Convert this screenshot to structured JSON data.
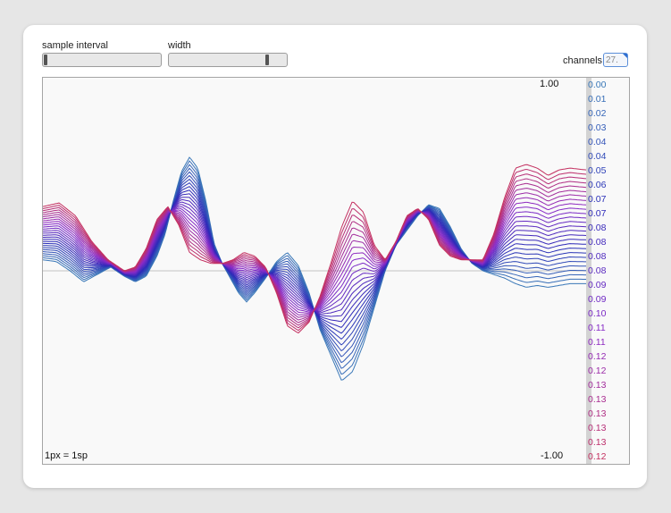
{
  "controls": {
    "sample_interval_label": "sample interval",
    "sample_interval_value": 0.0,
    "width_label": "width",
    "width_value": 0.85,
    "channels_label": "channels",
    "channels_value": "27."
  },
  "colors": {
    "trace_start": "#3a78b8",
    "trace_mid": "#2a2ab8",
    "trace_late": "#8a2ac8",
    "trace_end": "#c43060",
    "baseline": "#cfcfcf"
  },
  "plot": {
    "ymax_label": "1.00",
    "ymin_label": "-1.00",
    "scale_label": "1px = 1sp"
  },
  "chart_data": {
    "type": "line",
    "ylim": [
      -1,
      1
    ],
    "channel_count": 27,
    "channel_values": [
      "0.00",
      "0.01",
      "0.02",
      "0.03",
      "0.04",
      "0.04",
      "0.05",
      "0.06",
      "0.07",
      "0.07",
      "0.08",
      "0.08",
      "0.08",
      "0.08",
      "0.09",
      "0.09",
      "0.10",
      "0.11",
      "0.11",
      "0.12",
      "0.12",
      "0.13",
      "0.13",
      "0.13",
      "0.13",
      "0.13",
      "0.12"
    ],
    "first_channel_x": [
      0,
      0.025,
      0.05,
      0.075,
      0.1,
      0.125,
      0.15,
      0.17,
      0.19,
      0.21,
      0.225,
      0.24,
      0.255,
      0.27,
      0.285,
      0.3,
      0.315,
      0.33,
      0.345,
      0.36,
      0.375,
      0.39,
      0.41,
      0.43,
      0.45,
      0.47,
      0.49,
      0.51,
      0.53,
      0.55,
      0.57,
      0.59,
      0.61,
      0.63,
      0.65,
      0.67,
      0.69,
      0.71,
      0.73,
      0.75,
      0.77,
      0.79,
      0.81,
      0.83,
      0.85,
      0.87,
      0.89,
      0.91,
      0.93,
      0.95,
      0.97,
      1.0
    ],
    "first_channel_y": [
      0.06,
      0.05,
      0.0,
      -0.06,
      -0.02,
      0.02,
      -0.03,
      -0.06,
      -0.03,
      0.08,
      0.2,
      0.38,
      0.54,
      0.62,
      0.56,
      0.38,
      0.15,
      0.04,
      -0.04,
      -0.12,
      -0.17,
      -0.12,
      -0.04,
      0.05,
      0.1,
      0.03,
      -0.12,
      -0.32,
      -0.46,
      -0.6,
      -0.55,
      -0.4,
      -0.2,
      0.0,
      0.14,
      0.22,
      0.3,
      0.36,
      0.34,
      0.24,
      0.12,
      0.04,
      0.0,
      -0.02,
      -0.04,
      -0.07,
      -0.09,
      -0.08,
      -0.09,
      -0.08,
      -0.07,
      -0.07
    ],
    "last_channel_x": [
      0,
      0.03,
      0.06,
      0.09,
      0.12,
      0.15,
      0.17,
      0.19,
      0.21,
      0.23,
      0.25,
      0.27,
      0.29,
      0.31,
      0.33,
      0.35,
      0.37,
      0.39,
      0.41,
      0.43,
      0.45,
      0.47,
      0.49,
      0.51,
      0.53,
      0.55,
      0.57,
      0.59,
      0.61,
      0.63,
      0.65,
      0.67,
      0.69,
      0.71,
      0.73,
      0.75,
      0.77,
      0.79,
      0.81,
      0.83,
      0.85,
      0.87,
      0.89,
      0.91,
      0.93,
      0.95,
      0.97,
      1.0
    ],
    "last_channel_y": [
      0.35,
      0.37,
      0.3,
      0.16,
      0.06,
      0.0,
      0.02,
      0.12,
      0.28,
      0.35,
      0.25,
      0.1,
      0.06,
      0.04,
      0.04,
      0.06,
      0.1,
      0.08,
      0.02,
      -0.12,
      -0.3,
      -0.34,
      -0.28,
      -0.14,
      0.04,
      0.24,
      0.38,
      0.32,
      0.14,
      0.06,
      0.16,
      0.3,
      0.34,
      0.28,
      0.14,
      0.08,
      0.06,
      0.06,
      0.06,
      0.2,
      0.4,
      0.56,
      0.58,
      0.56,
      0.52,
      0.55,
      0.56,
      0.55
    ]
  }
}
